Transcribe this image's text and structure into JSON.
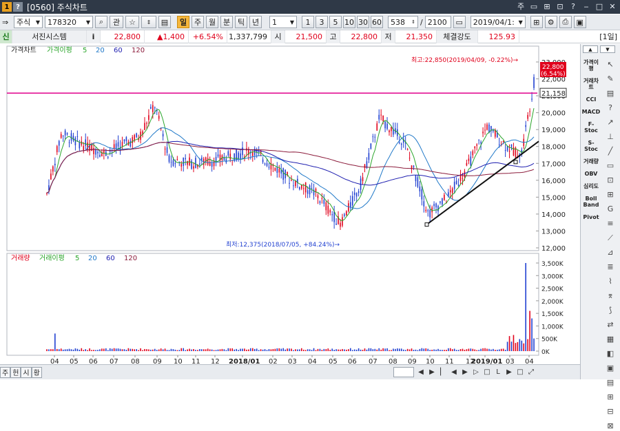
{
  "window": {
    "title": "[0560] 주식차트",
    "badge1": "1",
    "badge2": "?"
  },
  "titlebar_icons": [
    "주",
    "▭",
    "⊞",
    "⊡",
    "?",
    "‒",
    "□",
    "✕"
  ],
  "toolbar": {
    "market": "주식",
    "code": "178320",
    "tag_btn": "관",
    "period_active": "일",
    "periods": [
      "주",
      "월",
      "분",
      "틱",
      "년"
    ],
    "interval": "1",
    "intervals": [
      "1",
      "3",
      "5",
      "10",
      "30",
      "60"
    ],
    "count": "538",
    "total": "2100",
    "date": "2019/04/1:"
  },
  "quote": {
    "system_btn": "신",
    "system_label": "서진시스템",
    "info_btn": "i",
    "price": "22,800",
    "change": "▲1,400",
    "change_pct": "+6.54%",
    "volume": "1,337,799",
    "open_lbl": "시",
    "open": "21,500",
    "high_lbl": "고",
    "high": "22,800",
    "low_lbl": "저",
    "low": "21,350",
    "strength_lbl": "체결강도",
    "strength": "125.93",
    "period_tag": "[1일]"
  },
  "price_panel": {
    "legend": [
      "가격차트",
      "가격이평",
      "5",
      "20",
      "60",
      "120"
    ],
    "y_ticks": [
      "23,000",
      "22,000",
      "21,000",
      "20,000",
      "19,000",
      "18,000",
      "17,000",
      "16,000",
      "15,000",
      "14,000",
      "13,000",
      "12,000"
    ],
    "max_note": "최고:22,850(2019/04/09, -0.22%)→",
    "min_note": "최저:12,375(2018/07/05, +84.24%)→",
    "last_price": "22,800",
    "last_pct": "(6.54%)",
    "ref_line": "21,158"
  },
  "volume_panel": {
    "legend": [
      "거래량",
      "거래이평",
      "5",
      "20",
      "60",
      "120"
    ],
    "y_ticks": [
      "3,500K",
      "3,000K",
      "2,500K",
      "2,000K",
      "1,500K",
      "1,000K",
      "500K",
      "0K"
    ]
  },
  "x_axis": [
    "04",
    "05",
    "06",
    "07",
    "08",
    "09",
    "10",
    "11",
    "12",
    "2018/01",
    "02",
    "03",
    "04",
    "05",
    "06",
    "07",
    "08",
    "09",
    "10",
    "11",
    "12",
    "2019/01",
    "03",
    "04"
  ],
  "colors": {
    "ma5": "#2aa52a",
    "ma20": "#1f78c8",
    "ma60": "#1f1fb0",
    "ma120": "#8b1a3a",
    "up": "#e0001b",
    "down": "#1f3fd0",
    "ref": "#e0008c"
  },
  "right_panel": {
    "top": [
      "▲",
      "▼"
    ],
    "indicators": [
      "가격이평",
      "거래차트",
      "CCI",
      "MACD",
      "F-Stoc",
      "S-Stoc",
      "거래량",
      "OBV",
      "심리도",
      "Boll Band",
      "Pivot"
    ],
    "tools": [
      "↖",
      "✎",
      "▤",
      "?",
      "↗",
      "⊥",
      "╱",
      "▭",
      "⊡",
      "⊞",
      "G",
      "≡",
      "⟋",
      "⊿",
      "≣",
      "⌇",
      "⌆",
      "⟆",
      "⇄",
      "▦",
      "◧",
      "▣",
      "▤",
      "⊞",
      "⊟",
      "⊠"
    ]
  },
  "bottom": {
    "tabs": [
      "주",
      "헌",
      "시",
      "황"
    ],
    "nav": [
      "◀",
      "▶",
      "▏",
      "◀",
      "▶",
      "▷",
      "□",
      "L",
      "▶",
      "□",
      "⤢"
    ]
  },
  "chart_data": {
    "type": "candlestick",
    "price_range": [
      12000,
      23000
    ],
    "ma_series": [
      "5",
      "20",
      "60",
      "120"
    ],
    "notes": {
      "max": "22,850",
      "min": "12,375"
    },
    "volume_range": [
      0,
      3500
    ],
    "volume_unit": "K"
  }
}
